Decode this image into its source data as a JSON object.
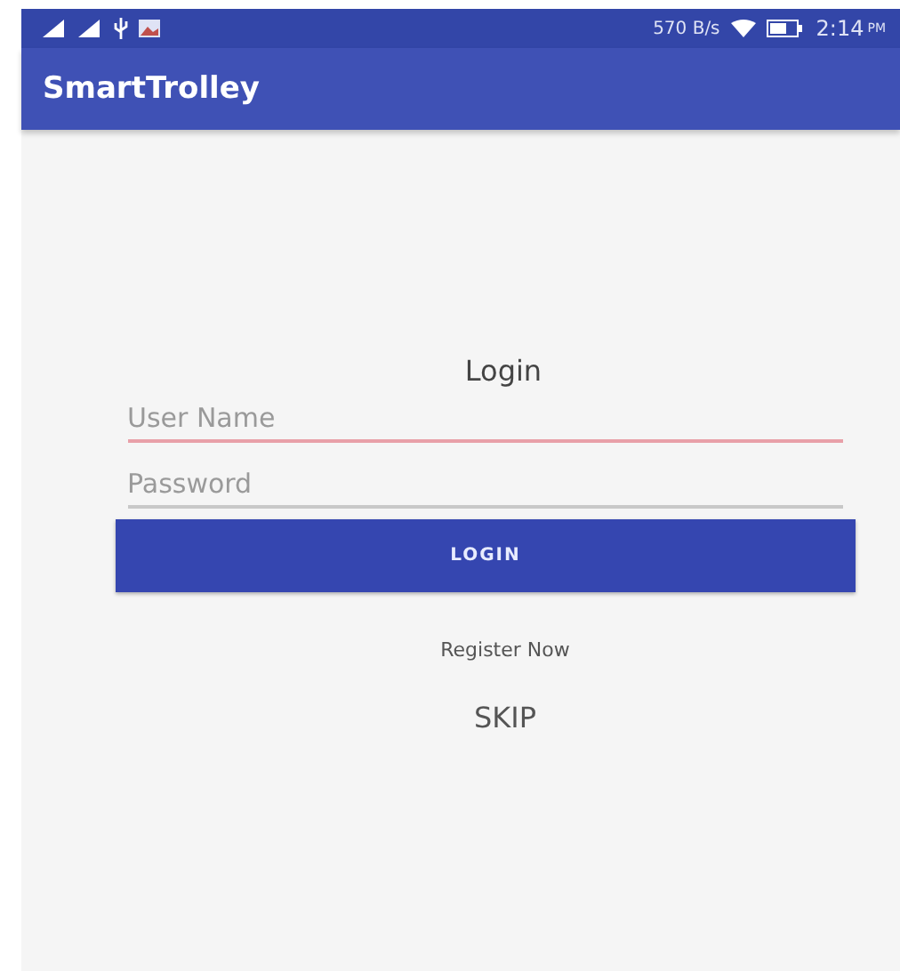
{
  "status_bar": {
    "speed": "570 B/s",
    "time": "2:14",
    "ampm": "PM"
  },
  "app_bar": {
    "title": "SmartTrolley"
  },
  "form": {
    "title": "Login",
    "fields": [
      {
        "placeholder": "User Name",
        "focused": true
      },
      {
        "placeholder": "Password",
        "focused": false
      }
    ],
    "button": "LOGIN",
    "links": [
      "Register Now",
      "SKIP"
    ]
  }
}
